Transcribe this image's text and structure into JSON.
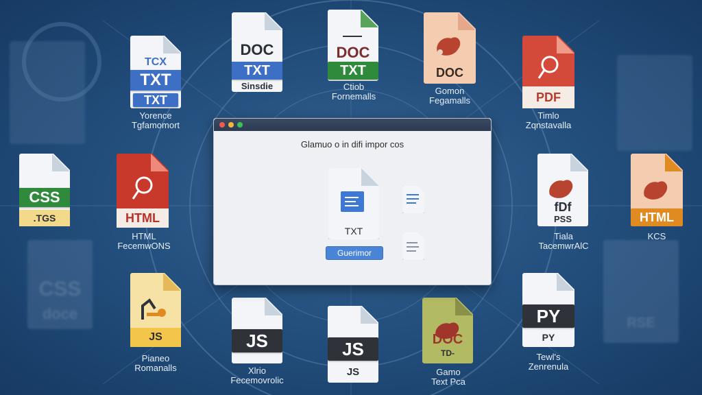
{
  "window": {
    "title": "Glamuo o in difi impor cos",
    "button_label": "Guerimor",
    "center_file_label": "TXT"
  },
  "icons": {
    "txt1": {
      "small": "TCX",
      "band": "TXT",
      "band2": "TXT",
      "caption": "Yorence\nTgfamomort"
    },
    "doc1": {
      "big": "DOC",
      "band": "TXT",
      "sub": "Sinsdie"
    },
    "doc2": {
      "big": "DOC",
      "band": "TXT",
      "caption": "Ctiob\nFornemalls"
    },
    "doc3": {
      "big": "DOC",
      "caption": "Gomon\nFegamalls"
    },
    "pdf1": {
      "band": "PDF",
      "caption": "Timlo\nZqnstavalla"
    },
    "css1": {
      "band": "CSS",
      "sub": ".TGS"
    },
    "html1": {
      "band": "HTML",
      "caption": "HTML\nFecemwONS"
    },
    "pdf2": {
      "big": "fDf",
      "sub": "PSS",
      "caption": "Tiala\nTacemwrAlC"
    },
    "html2": {
      "band": "HTML",
      "caption": "KCS"
    },
    "js1": {
      "band": "JS",
      "caption": "Pianeo\nRomanalls"
    },
    "js2": {
      "band": "JS",
      "caption": "Xlrio\nFecemovrolic"
    },
    "js3": {
      "band": "JS",
      "sub": "JS"
    },
    "doc4": {
      "big": "DOC",
      "sub": "TD-",
      "caption": "Gamo\nText Pca"
    },
    "py1": {
      "band": "PY",
      "sub": "PY",
      "caption": "Tewl's\nZenrenula"
    },
    "ghost1": {
      "text": "CSS",
      "sub": "doce"
    },
    "ghost2": {
      "text": "RSE"
    }
  },
  "colors": {
    "blue": "#3d6fc5",
    "green": "#2f8a3c",
    "red": "#c0392b",
    "orange": "#e08a22",
    "dark": "#2f3339",
    "peach": "#f4cdb1",
    "yellow": "#f3d98a",
    "olive": "#b3ba64"
  }
}
